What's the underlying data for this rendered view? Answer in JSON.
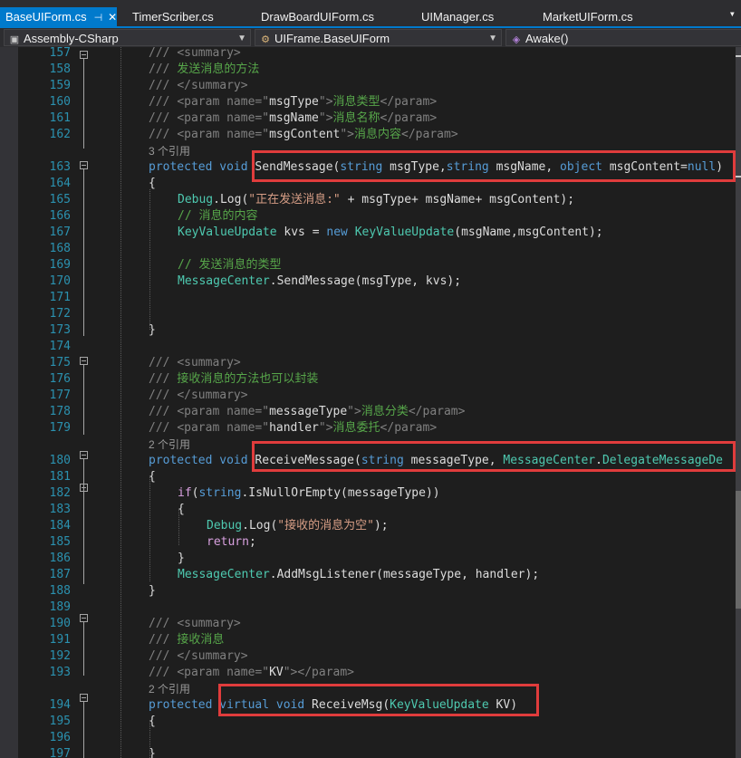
{
  "tabs": [
    {
      "label": "BaseUIForm.cs",
      "active": true,
      "pin": "⊣",
      "close": "✕"
    },
    {
      "label": "TimerScriber.cs"
    },
    {
      "label": "DrawBoardUIForm.cs"
    },
    {
      "label": "UIManager.cs"
    },
    {
      "label": "MarketUIForm.cs"
    }
  ],
  "tab_menu_icon": "dropdown-icon",
  "nav": {
    "project": "Assembly-CSharp",
    "class": "UIFrame.BaseUIForm",
    "member": "Awake()"
  },
  "colors": {
    "accent": "#007acc",
    "highlight_box": "#e03c3c",
    "keyword": "#569cd6",
    "type": "#4ec9b0",
    "string": "#d69d85",
    "comment": "#57a64a",
    "line_number": "#2b91af"
  },
  "lines": [
    {
      "n": "157",
      "i": 2,
      "t": [
        [
          "c-xd",
          "/// "
        ],
        [
          "c-xd",
          "<summary>"
        ]
      ]
    },
    {
      "n": "158",
      "i": 2,
      "t": [
        [
          "c-xd",
          "/// "
        ],
        [
          "c-cm",
          "发送消息的方法"
        ]
      ]
    },
    {
      "n": "159",
      "i": 2,
      "t": [
        [
          "c-xd",
          "/// "
        ],
        [
          "c-xd",
          "</summary>"
        ]
      ]
    },
    {
      "n": "160",
      "i": 2,
      "t": [
        [
          "c-xd",
          "/// "
        ],
        [
          "c-xd",
          "<param "
        ],
        [
          "c-xd",
          "name"
        ],
        [
          "c-xd",
          "=\""
        ],
        [
          "",
          "msgType"
        ],
        [
          "c-xd",
          "\">"
        ],
        [
          "c-cm",
          "消息类型"
        ],
        [
          "c-xd",
          "</param>"
        ]
      ]
    },
    {
      "n": "161",
      "i": 2,
      "t": [
        [
          "c-xd",
          "/// "
        ],
        [
          "c-xd",
          "<param "
        ],
        [
          "c-xd",
          "name"
        ],
        [
          "c-xd",
          "=\""
        ],
        [
          "",
          "msgName"
        ],
        [
          "c-xd",
          "\">"
        ],
        [
          "c-cm",
          "消息名称"
        ],
        [
          "c-xd",
          "</param>"
        ]
      ]
    },
    {
      "n": "162",
      "i": 2,
      "t": [
        [
          "c-xd",
          "/// "
        ],
        [
          "c-xd",
          "<param "
        ],
        [
          "c-xd",
          "name"
        ],
        [
          "c-xd",
          "=\""
        ],
        [
          "",
          "msgContent"
        ],
        [
          "c-xd",
          "\">"
        ],
        [
          "c-cm",
          "消息内容"
        ],
        [
          "c-xd",
          "</param>"
        ]
      ]
    },
    {
      "n": "",
      "i": 2,
      "ref": "3 个引用"
    },
    {
      "n": "163",
      "i": 2,
      "t": [
        [
          "c-kw",
          "protected "
        ],
        [
          "c-kw",
          "void "
        ],
        [
          "",
          "SendMessage("
        ],
        [
          "c-kw",
          "string "
        ],
        [
          "",
          "msgType,"
        ],
        [
          "c-kw",
          "string "
        ],
        [
          "",
          "msgName, "
        ],
        [
          "c-kw",
          "object "
        ],
        [
          "",
          "msgContent="
        ],
        [
          "c-kw",
          "null"
        ],
        [
          "",
          ")"
        ]
      ]
    },
    {
      "n": "164",
      "i": 2,
      "t": [
        [
          "",
          "{"
        ]
      ]
    },
    {
      "n": "165",
      "i": 3,
      "t": [
        [
          "c-ty",
          "Debug"
        ],
        [
          "",
          "."
        ],
        [
          "",
          "Log("
        ],
        [
          "c-st",
          "\"正在发送消息:\""
        ],
        [
          "",
          " + msgType+ msgName+ msgContent);"
        ]
      ]
    },
    {
      "n": "166",
      "i": 3,
      "t": [
        [
          "c-cm",
          "// 消息的内容"
        ]
      ]
    },
    {
      "n": "167",
      "i": 3,
      "t": [
        [
          "c-ty",
          "KeyValueUpdate"
        ],
        [
          "",
          " kvs = "
        ],
        [
          "c-kw",
          "new "
        ],
        [
          "c-ty",
          "KeyValueUpdate"
        ],
        [
          "",
          "(msgName,msgContent);"
        ]
      ]
    },
    {
      "n": "168",
      "i": 3,
      "t": []
    },
    {
      "n": "169",
      "i": 3,
      "t": [
        [
          "c-cm",
          "// 发送消息的类型"
        ]
      ]
    },
    {
      "n": "170",
      "i": 3,
      "t": [
        [
          "c-ty",
          "MessageCenter"
        ],
        [
          "",
          ".SendMessage(msgType, kvs);"
        ]
      ]
    },
    {
      "n": "171",
      "i": 3,
      "t": []
    },
    {
      "n": "172",
      "i": 3,
      "t": []
    },
    {
      "n": "173",
      "i": 2,
      "t": [
        [
          "",
          "}"
        ]
      ]
    },
    {
      "n": "174",
      "i": 2,
      "t": []
    },
    {
      "n": "175",
      "i": 2,
      "t": [
        [
          "c-xd",
          "/// "
        ],
        [
          "c-xd",
          "<summary>"
        ]
      ]
    },
    {
      "n": "176",
      "i": 2,
      "t": [
        [
          "c-xd",
          "/// "
        ],
        [
          "c-cm",
          "接收消息的方法也可以封装"
        ]
      ]
    },
    {
      "n": "177",
      "i": 2,
      "t": [
        [
          "c-xd",
          "/// "
        ],
        [
          "c-xd",
          "</summary>"
        ]
      ]
    },
    {
      "n": "178",
      "i": 2,
      "t": [
        [
          "c-xd",
          "/// "
        ],
        [
          "c-xd",
          "<param "
        ],
        [
          "c-xd",
          "name"
        ],
        [
          "c-xd",
          "=\""
        ],
        [
          "",
          "messageType"
        ],
        [
          "c-xd",
          "\">"
        ],
        [
          "c-cm",
          "消息分类"
        ],
        [
          "c-xd",
          "</param>"
        ]
      ]
    },
    {
      "n": "179",
      "i": 2,
      "t": [
        [
          "c-xd",
          "/// "
        ],
        [
          "c-xd",
          "<param "
        ],
        [
          "c-xd",
          "name"
        ],
        [
          "c-xd",
          "=\""
        ],
        [
          "",
          "handler"
        ],
        [
          "c-xd",
          "\">"
        ],
        [
          "c-cm",
          "消息委托"
        ],
        [
          "c-xd",
          "</param>"
        ]
      ]
    },
    {
      "n": "",
      "i": 2,
      "ref": "2 个引用"
    },
    {
      "n": "180",
      "i": 2,
      "t": [
        [
          "c-kw",
          "protected "
        ],
        [
          "c-kw",
          "void "
        ],
        [
          "",
          "ReceiveMessage("
        ],
        [
          "c-kw",
          "string "
        ],
        [
          "",
          "messageType, "
        ],
        [
          "c-ty",
          "MessageCenter"
        ],
        [
          "",
          "."
        ],
        [
          "c-ty",
          "DelegateMessageDe"
        ]
      ]
    },
    {
      "n": "181",
      "i": 2,
      "t": [
        [
          "",
          "{"
        ]
      ]
    },
    {
      "n": "182",
      "i": 3,
      "t": [
        [
          "c-ctl",
          "if"
        ],
        [
          "",
          "("
        ],
        [
          "c-kw",
          "string"
        ],
        [
          "",
          ".IsNullOrEmpty(messageType))"
        ]
      ]
    },
    {
      "n": "183",
      "i": 3,
      "t": [
        [
          "",
          "{"
        ]
      ]
    },
    {
      "n": "184",
      "i": 4,
      "t": [
        [
          "c-ty",
          "Debug"
        ],
        [
          "",
          ".Log("
        ],
        [
          "c-st",
          "\"接收的消息为空\""
        ],
        [
          "",
          ");"
        ]
      ]
    },
    {
      "n": "185",
      "i": 4,
      "t": [
        [
          "c-ctl",
          "return"
        ],
        [
          "",
          ";"
        ]
      ]
    },
    {
      "n": "186",
      "i": 3,
      "t": [
        [
          "",
          "}"
        ]
      ]
    },
    {
      "n": "187",
      "i": 3,
      "t": [
        [
          "c-ty",
          "MessageCenter"
        ],
        [
          "",
          ".AddMsgListener(messageType, handler);"
        ]
      ]
    },
    {
      "n": "188",
      "i": 2,
      "t": [
        [
          "",
          "}"
        ]
      ]
    },
    {
      "n": "189",
      "i": 2,
      "t": []
    },
    {
      "n": "190",
      "i": 2,
      "t": [
        [
          "c-xd",
          "/// "
        ],
        [
          "c-xd",
          "<summary>"
        ]
      ]
    },
    {
      "n": "191",
      "i": 2,
      "t": [
        [
          "c-xd",
          "/// "
        ],
        [
          "c-cm",
          "接收消息"
        ]
      ]
    },
    {
      "n": "192",
      "i": 2,
      "t": [
        [
          "c-xd",
          "/// "
        ],
        [
          "c-xd",
          "</summary>"
        ]
      ]
    },
    {
      "n": "193",
      "i": 2,
      "t": [
        [
          "c-xd",
          "/// "
        ],
        [
          "c-xd",
          "<param "
        ],
        [
          "c-xd",
          "name"
        ],
        [
          "c-xd",
          "=\""
        ],
        [
          "",
          "KV"
        ],
        [
          "c-xd",
          "\">"
        ],
        [
          "c-xd",
          "</param>"
        ]
      ]
    },
    {
      "n": "",
      "i": 2,
      "ref": "2 个引用"
    },
    {
      "n": "194",
      "i": 2,
      "t": [
        [
          "c-kw",
          "protected "
        ],
        [
          "c-kw",
          "virtual "
        ],
        [
          "c-kw",
          "void "
        ],
        [
          "",
          "ReceiveMsg("
        ],
        [
          "c-ty",
          "KeyValueUpdate"
        ],
        [
          "",
          " KV)"
        ]
      ]
    },
    {
      "n": "195",
      "i": 2,
      "t": [
        [
          "",
          "{"
        ]
      ]
    },
    {
      "n": "196",
      "i": 2,
      "t": []
    },
    {
      "n": "197",
      "i": 2,
      "t": [
        [
          "",
          "}"
        ]
      ]
    }
  ]
}
